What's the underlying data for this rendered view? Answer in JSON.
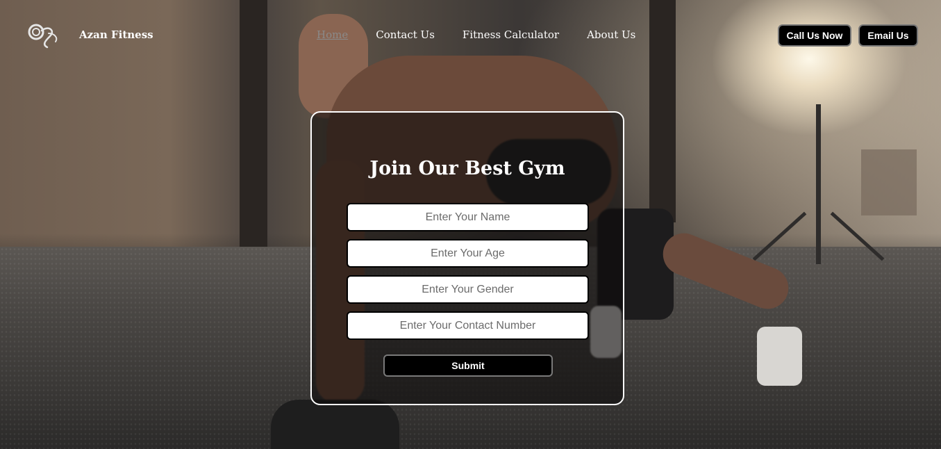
{
  "brand": {
    "logo_icon": "dumbbell-logo-icon",
    "name": "Azan Fitness"
  },
  "nav": {
    "links": [
      {
        "label": "Home",
        "active": true
      },
      {
        "label": "Contact Us",
        "active": false
      },
      {
        "label": "Fitness Calculator",
        "active": false
      },
      {
        "label": "About Us",
        "active": false
      }
    ],
    "call_button": "Call Us Now",
    "email_button": "Email Us"
  },
  "form": {
    "title": "Join Our Best Gym",
    "fields": [
      {
        "placeholder": "Enter Your Name",
        "value": ""
      },
      {
        "placeholder": "Enter Your Age",
        "value": ""
      },
      {
        "placeholder": "Enter Your Gender",
        "value": ""
      },
      {
        "placeholder": "Enter Your Contact Number",
        "value": ""
      }
    ],
    "submit_label": "Submit"
  },
  "colors": {
    "button_bg": "#000000",
    "text_light": "#ffffff",
    "active_link": "#8a8a8a",
    "card_border": "#ffffff"
  }
}
